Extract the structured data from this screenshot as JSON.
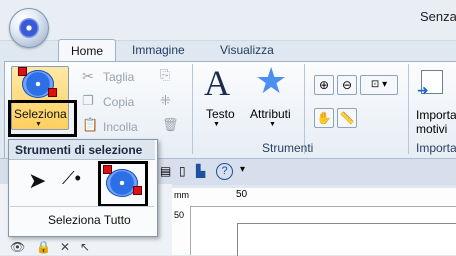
{
  "app": {
    "title": "Senza"
  },
  "tabs": [
    {
      "label": "Home",
      "active": true
    },
    {
      "label": "Immagine",
      "active": false
    },
    {
      "label": "Visualizza",
      "active": false
    }
  ],
  "ribbon": {
    "seleziona_label": "Seleziona",
    "clipboard": {
      "taglia": "Taglia",
      "copia": "Copia",
      "incolla": "Incolla"
    },
    "strumenti": {
      "testo": "Testo",
      "attributi": "Attributi",
      "group_label": "Strumenti"
    },
    "importa": {
      "label_line1": "Importa",
      "label_line2": "motivi",
      "group_label": "Importa"
    }
  },
  "dropdown": {
    "title": "Strumenti di selezione",
    "select_all": "Seleziona Tutto"
  },
  "ruler": {
    "unit": "mm",
    "mark": "50",
    "vmark": "50"
  },
  "colors": {
    "accent_selected": "#ffcf5e",
    "ribbon_bg": "#e6edf5"
  }
}
